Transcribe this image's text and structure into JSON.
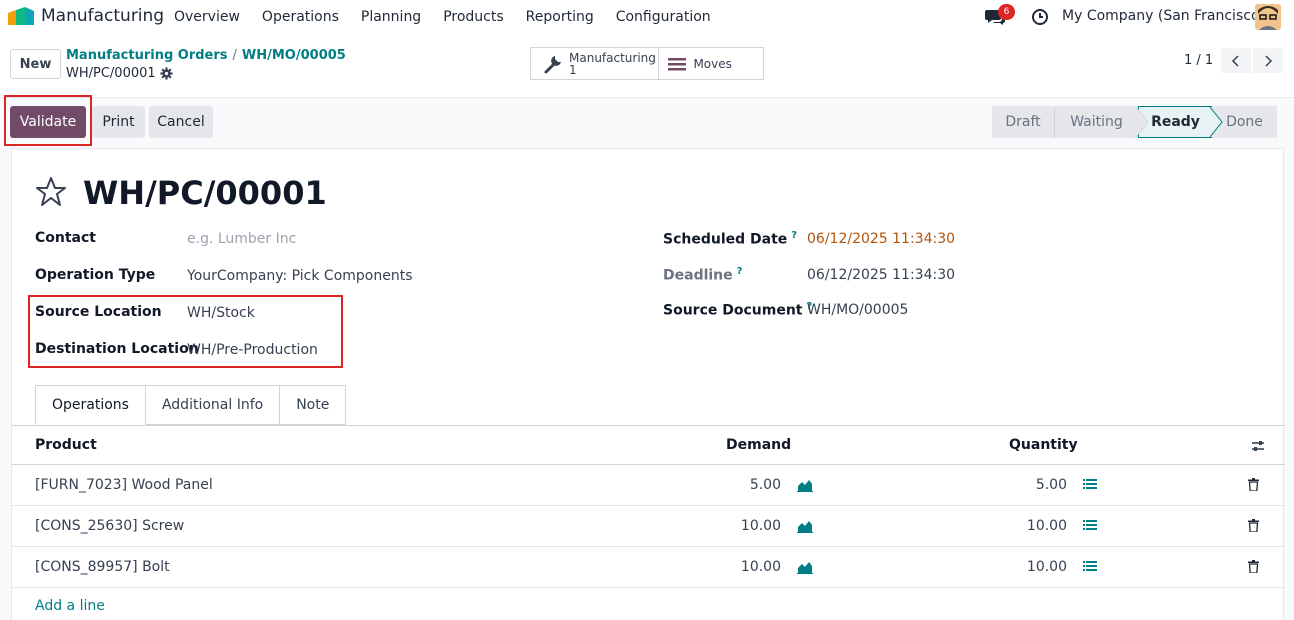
{
  "navbar": {
    "app_name": "Manufacturing",
    "menu": [
      "Overview",
      "Operations",
      "Planning",
      "Products",
      "Reporting",
      "Configuration"
    ],
    "messages_count": "6",
    "company": "My Company (San Francisco)"
  },
  "control": {
    "new_label": "New",
    "breadcrumb": [
      "Manufacturing Orders",
      "WH/MO/00005"
    ],
    "breadcrumb_sep": "/",
    "record": "WH/PC/00001",
    "smart_buttons": [
      {
        "label": "Manufacturing",
        "value": "1",
        "icon": "wrench-icon"
      },
      {
        "label": "Moves",
        "icon": "list-icon"
      }
    ],
    "pager": "1 / 1"
  },
  "statusbar": {
    "validate": "Validate",
    "print": "Print",
    "cancel": "Cancel",
    "stages": [
      "Draft",
      "Waiting",
      "Ready",
      "Done"
    ],
    "active_stage": "Ready"
  },
  "form": {
    "title": "WH/PC/00001",
    "fields_left": [
      {
        "label": "Contact",
        "value": "e.g. Lumber Inc",
        "placeholder": true
      },
      {
        "label": "Operation Type",
        "value": "YourCompany: Pick Components"
      },
      {
        "label": "Source Location",
        "value": "WH/Stock"
      },
      {
        "label": "Destination Location",
        "value": "WH/Pre-Production"
      }
    ],
    "fields_right": [
      {
        "label": "Scheduled Date",
        "value": "06/12/2025 11:34:30",
        "help": "?"
      },
      {
        "label": "Deadline",
        "value": "06/12/2025 11:34:30",
        "help": "?"
      },
      {
        "label": "Source Document",
        "value": "WH/MO/00005",
        "help": "?"
      }
    ],
    "tabs": [
      "Operations",
      "Additional Info",
      "Note"
    ],
    "table": {
      "headers": [
        "Product",
        "Demand",
        "Quantity"
      ],
      "rows": [
        {
          "product": "[FURN_7023] Wood Panel",
          "demand": "5.00",
          "quantity": "5.00"
        },
        {
          "product": "[CONS_25630] Screw",
          "demand": "10.00",
          "quantity": "10.00"
        },
        {
          "product": "[CONS_89957] Bolt",
          "demand": "10.00",
          "quantity": "10.00"
        }
      ],
      "add_line": "Add a line"
    }
  },
  "colors": {
    "primary": "#714b67",
    "accent": "#017e84",
    "highlight": "#dc2626",
    "warning": "#b45309"
  }
}
